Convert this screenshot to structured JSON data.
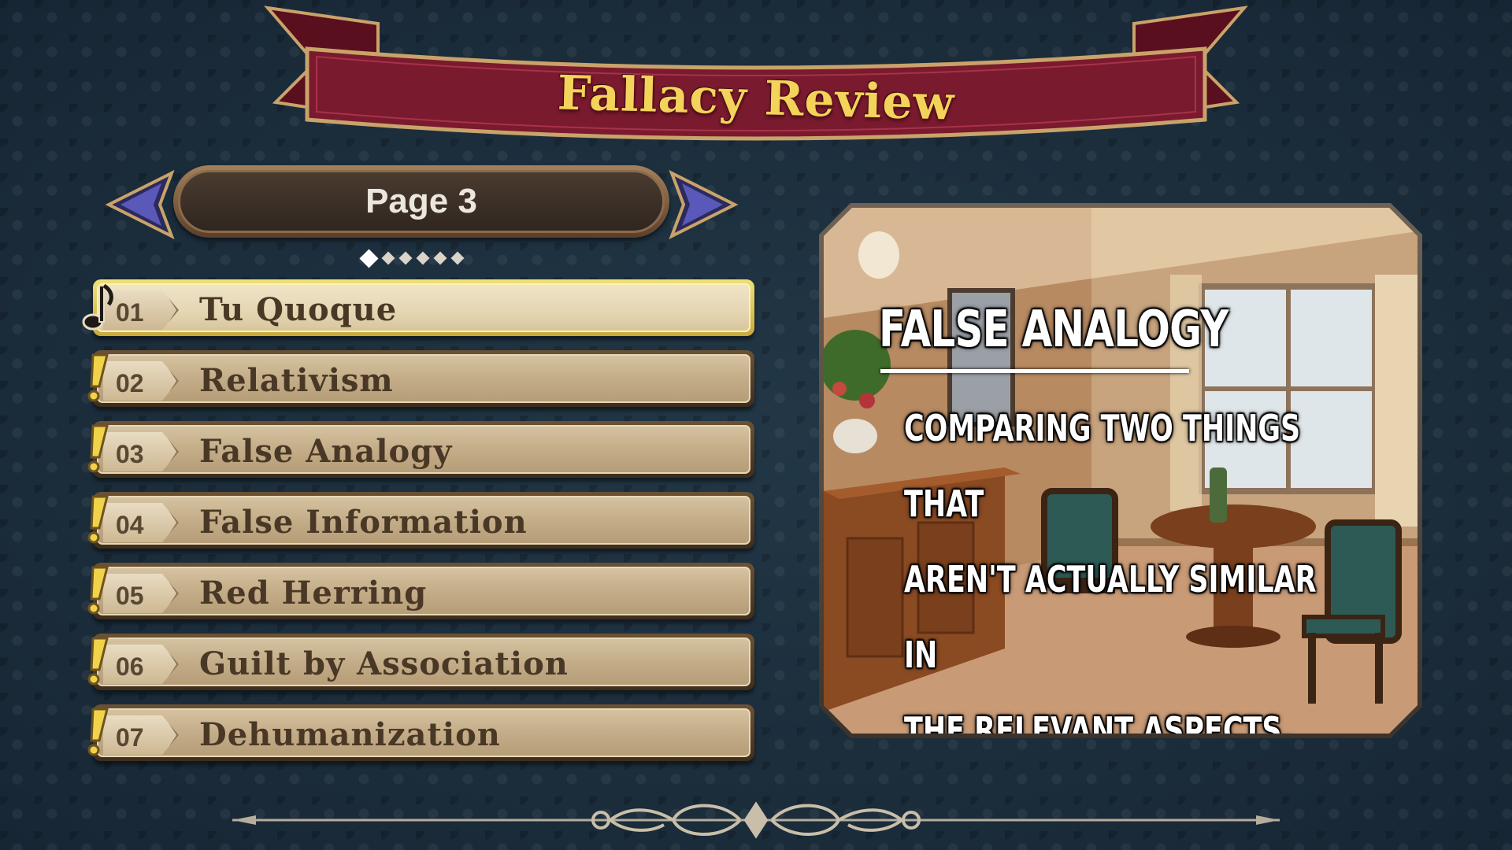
{
  "screen": {
    "title": "Fallacy Review"
  },
  "pager": {
    "label": "Page 3",
    "total_pages": 6,
    "current_index": 1
  },
  "fallacies": [
    {
      "number": "01",
      "label": "Tu Quoque",
      "selected": true,
      "marker_icon": "music-note-icon"
    },
    {
      "number": "02",
      "label": "Relativism",
      "selected": false,
      "marker_icon": "exclamation-icon"
    },
    {
      "number": "03",
      "label": "False Analogy",
      "selected": false,
      "marker_icon": "exclamation-icon"
    },
    {
      "number": "04",
      "label": "False Information",
      "selected": false,
      "marker_icon": "exclamation-icon"
    },
    {
      "number": "05",
      "label": "Red Herring",
      "selected": false,
      "marker_icon": "exclamation-icon"
    },
    {
      "number": "06",
      "label": "Guilt by Association",
      "selected": false,
      "marker_icon": "exclamation-icon"
    },
    {
      "number": "07",
      "label": "Dehumanization",
      "selected": false,
      "marker_icon": "exclamation-icon"
    }
  ],
  "preview": {
    "title": "False Analogy",
    "description_lines": [
      "Comparing two things that",
      "aren't actually similar in",
      "the relevant aspects."
    ]
  },
  "colors": {
    "banner": "#7a1a2e",
    "banner_text": "#f3d35a",
    "arrow": "#5a58b8",
    "item_bg": "#c9b48e",
    "item_selected_border": "#f0e07a"
  }
}
